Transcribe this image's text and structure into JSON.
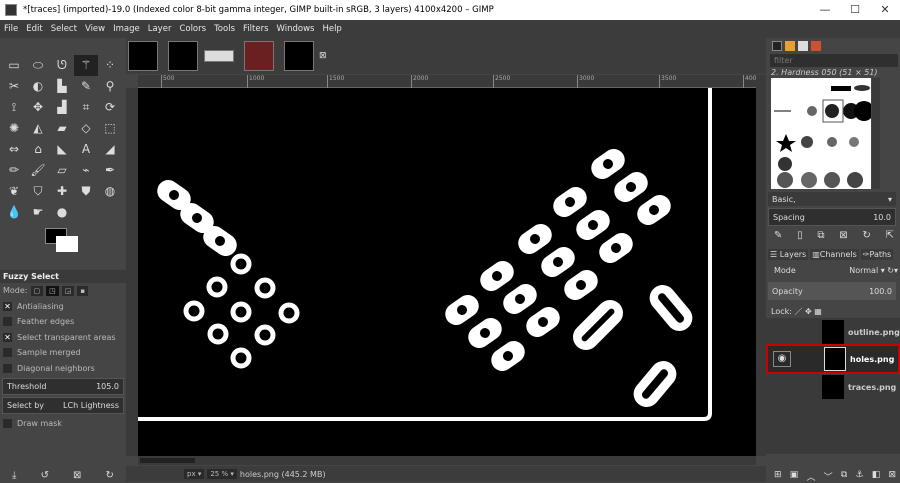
{
  "window": {
    "title": "*[traces] (imported)-19.0 (Indexed color 8-bit gamma integer, GIMP built-in sRGB, 3 layers) 4100x4200 – GIMP",
    "minimize": "—",
    "maximize": "☐",
    "close": "✕"
  },
  "menu": [
    "File",
    "Edit",
    "Select",
    "View",
    "Image",
    "Layer",
    "Colors",
    "Tools",
    "Filters",
    "Windows",
    "Help"
  ],
  "tool_options": {
    "title": "Fuzzy Select",
    "mode_label": "Mode:",
    "antialiasing": "Antialiasing",
    "feather_edges": "Feather edges",
    "select_transparent": "Select transparent areas",
    "sample_merged": "Sample merged",
    "diagonal_neighbors": "Diagonal neighbors",
    "threshold_label": "Threshold",
    "threshold_value": "105.0",
    "select_by_label": "Select by",
    "select_by_value": "LCh Lightness",
    "draw_mask": "Draw mask"
  },
  "ruler": [
    "500",
    "1000",
    "1500",
    "2000",
    "2500",
    "3000",
    "3500",
    "4000"
  ],
  "status": {
    "unit": "px",
    "zoom": "25 %",
    "info": "holes.png (445.2 MB)"
  },
  "brushes": {
    "filter_placeholder": "filter",
    "selected": "2. Hardness 050 (51 × 51)",
    "preset": "Basic,",
    "spacing_label": "Spacing",
    "spacing_value": "10.0"
  },
  "layers_panel": {
    "tabs": [
      "Layers",
      "Channels",
      "Paths"
    ],
    "mode_label": "Mode",
    "mode_value": "Normal",
    "opacity_label": "Opacity",
    "opacity_value": "100.0",
    "lock_label": "Lock:",
    "layers": [
      {
        "name": "outline.png"
      },
      {
        "name": "holes.png"
      },
      {
        "name": "traces.png"
      }
    ]
  },
  "highlight_color": "#cc0000"
}
